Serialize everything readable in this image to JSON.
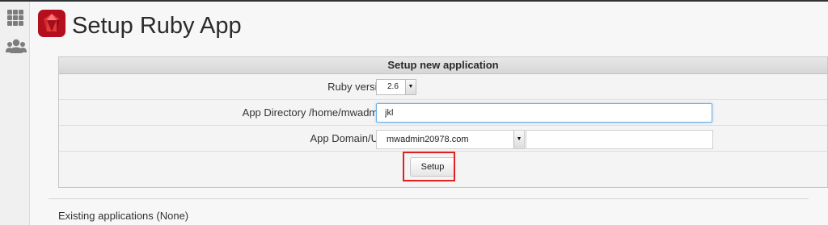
{
  "page": {
    "title": "Setup Ruby App"
  },
  "sidebar": {
    "icons": [
      "grid-icon",
      "users-icon"
    ]
  },
  "form": {
    "header": "Setup new application",
    "ruby_version": {
      "label": "Ruby version",
      "value": "2.6"
    },
    "app_directory": {
      "label": "App Directory /home/mwadmin/",
      "value": "jkl"
    },
    "app_domain": {
      "label": "App Domain/URI",
      "domain": "mwadmin20978.com",
      "uri": ""
    },
    "setup_button": "Setup"
  },
  "existing": {
    "text": "Existing applications (None)"
  },
  "colors": {
    "highlight": "#e0201f",
    "focus": "#66afe9",
    "ruby": "#c8102e"
  }
}
